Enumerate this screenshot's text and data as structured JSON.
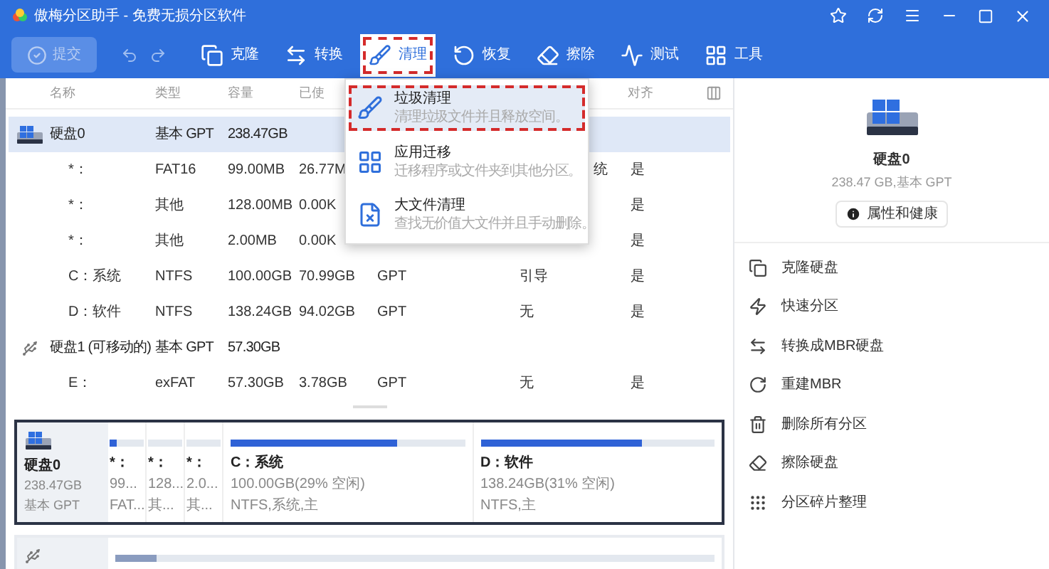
{
  "window": {
    "title": "傲梅分区助手 - 免费无损分区软件"
  },
  "toolbar": {
    "submit": {
      "label": "提交",
      "disabled": true
    },
    "tools": [
      {
        "label": "克隆",
        "selected": false
      },
      {
        "label": "转换",
        "selected": false
      },
      {
        "label": "清理",
        "selected": true
      },
      {
        "label": "恢复",
        "selected": false
      },
      {
        "label": "擦除",
        "selected": false
      },
      {
        "label": "测试",
        "selected": false
      },
      {
        "label": "工具",
        "selected": false
      }
    ]
  },
  "clean_menu": {
    "items": [
      {
        "title": "垃圾清理",
        "description": "清理垃圾文件并且释放空间。",
        "selected": true
      },
      {
        "title": "应用迁移",
        "description": "迁移程序或文件夹到其他分区。",
        "selected": false
      },
      {
        "title": "大文件清理",
        "description": "查找无价值大文件并且手动删除。",
        "selected": false
      }
    ]
  },
  "table": {
    "columns": [
      "名称",
      "类型",
      "容量",
      "已使"
    ],
    "column_7": "对齐",
    "rows": [
      {
        "kind": "disk",
        "selected": true,
        "cells": [
          "硬盘0",
          "基本 GPT",
          "238.47GB",
          null,
          null,
          null,
          null
        ]
      },
      {
        "kind": "partition",
        "selected": false,
        "cells": [
          "*：",
          "FAT16",
          "99.00MB",
          "26.77M",
          null,
          "统",
          "是"
        ],
        "partly_covered": true
      },
      {
        "kind": "partition",
        "selected": false,
        "cells": [
          "*：",
          "其他",
          "128.00MB",
          "0.00K",
          null,
          null,
          "是"
        ]
      },
      {
        "kind": "partition",
        "selected": false,
        "cells": [
          "*：",
          "其他",
          "2.00MB",
          "0.00K",
          null,
          null,
          "是"
        ]
      },
      {
        "kind": "partition",
        "selected": false,
        "cells": [
          "C：系统",
          "NTFS",
          "100.00GB",
          "70.99GB",
          "GPT",
          "引导",
          "是"
        ]
      },
      {
        "kind": "partition",
        "selected": false,
        "cells": [
          "D：软件",
          "NTFS",
          "138.24GB",
          "94.02GB",
          "GPT",
          "无",
          "是"
        ]
      },
      {
        "kind": "removable",
        "selected": false,
        "cells": [
          "硬盘1 (可移动的)",
          "基本 GPT",
          "57.30GB",
          null,
          null,
          null,
          null
        ]
      },
      {
        "kind": "partition",
        "selected": false,
        "cells": [
          "E：",
          "exFAT",
          "57.30GB",
          "3.78GB",
          "GPT",
          "无",
          "是"
        ]
      }
    ]
  },
  "disk_map": [
    {
      "kind": "disk",
      "selected": true,
      "name": "硬盘0",
      "size": "238.47GB",
      "type": "基本 GPT",
      "partitions": [
        {
          "kind": "small",
          "name": "*：",
          "size": "99...",
          "fs": "FAT...",
          "level": 0.2
        },
        {
          "kind": "small",
          "name": "*：",
          "size": "128...",
          "fs": "其...",
          "level": 0
        },
        {
          "kind": "small",
          "name": "*：",
          "size": "2.0...",
          "fs": "其...",
          "level": 0
        },
        {
          "kind": "large",
          "name": "C：系统",
          "size": "100.00GB(29% 空闲)",
          "fs": "NTFS,系统,主",
          "level": 0.71
        },
        {
          "kind": "large",
          "name": "D：软件",
          "size": "138.24GB(31% 空闲)",
          "fs": "NTFS,主",
          "level": 0.69
        }
      ]
    },
    {
      "kind": "removable",
      "selected": false,
      "partitions": [
        {
          "kind": "large",
          "level": 0.07
        }
      ]
    }
  ],
  "side_panel": {
    "disk_name": "硬盘0",
    "disk_info": "238.47 GB,基本 GPT",
    "properties_button": "属性和健康",
    "actions": [
      "克隆硬盘",
      "快速分区",
      "转换成MBR硬盘",
      "重建MBR",
      "删除所有分区",
      "擦除硬盘",
      "分区碎片整理"
    ]
  }
}
